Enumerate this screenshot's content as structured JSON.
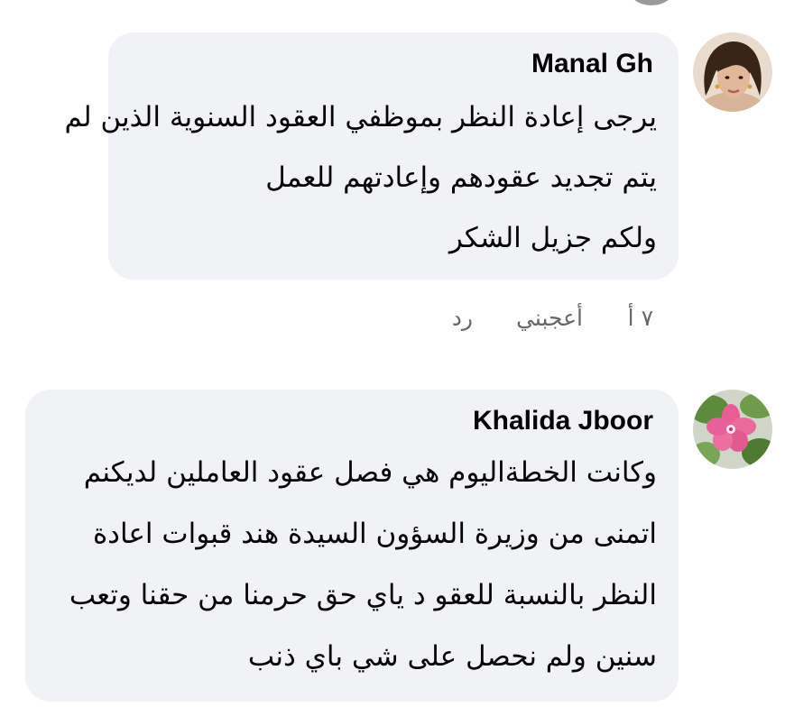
{
  "comments": [
    {
      "author": "Manal Gh",
      "lines": [
        "يرجى إعادة النظر بموظفي العقود السنوية الذين لم",
        "يتم تجديد عقودهم وإعادتهم للعمل",
        "ولكم جزيل الشكر"
      ],
      "time": "٧ أ",
      "like_label": "أعجبني",
      "reply_label": "رد"
    },
    {
      "author": "Khalida Jboor",
      "lines": [
        "وكانت الخطةاليوم هي فصل عقود العاملين لديكنم",
        "اتمنى من وزيرة السؤون السيدة هند قبوات اعادة",
        "النظر بالنسبة للعقو د ياي حق حرمنا من حقنا وتعب",
        "سنين ولم نحصل على شي باي ذنب"
      ]
    }
  ],
  "colors": {
    "bubble_bg": "#f0f2f5",
    "meta_text": "#65676b",
    "text": "#050505"
  }
}
